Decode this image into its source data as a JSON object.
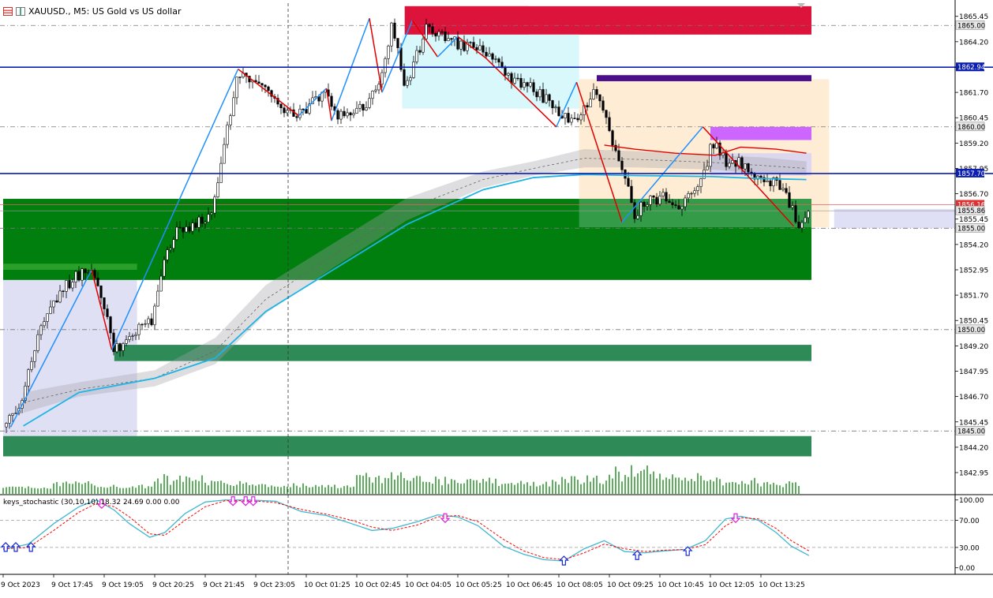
{
  "header": {
    "symbol_title": "XAUUSD., M5:  US Gold vs US dollar",
    "indicator_label": "keys_stochastic (30,10,10) 18.32 24.69 0.00 0.00"
  },
  "colors": {
    "bull": "#000000",
    "bear": "#000000",
    "hline": "#0b1fb0",
    "supply": "#dc143c",
    "demand": "#007f0e",
    "demand_light": "#2e8b57",
    "purple": "#4b0f8c",
    "violet": "#cc66ff",
    "zigzag_up": "#1e90ff",
    "zigzag_down": "#e00000",
    "ma_blue": "#1eb4e6",
    "stoch_main": "#3fb8d0",
    "stoch_signal": "#ff0000"
  },
  "chart_data": [
    {
      "type": "candlestick",
      "title": "XAUUSD., M5:  US Gold vs US dollar",
      "x_tick_labels": [
        "9 Oct 2023",
        "9 Oct 17:45",
        "9 Oct 19:05",
        "9 Oct 20:25",
        "9 Oct 21:45",
        "9 Oct 23:05",
        "10 Oct 01:25",
        "10 Oct 02:45",
        "10 Oct 04:05",
        "10 Oct 05:25",
        "10 Oct 06:45",
        "10 Oct 08:05",
        "10 Oct 09:25",
        "10 Oct 10:45",
        "10 Oct 12:05",
        "10 Oct 13:25"
      ],
      "y_tick_labels": [
        "1865.45",
        "1864.20",
        "1861.70",
        "1860.45",
        "1859.20",
        "1857.95",
        "1856.70",
        "1855.45",
        "1854.20",
        "1852.95",
        "1851.70",
        "1850.45",
        "1849.20",
        "1847.95",
        "1846.70",
        "1845.45",
        "1844.20",
        "1842.95"
      ],
      "ylim": [
        1841.9,
        1866.1
      ],
      "price_labels": [
        {
          "price": 1865.0,
          "text": "1865.00",
          "style": "grey"
        },
        {
          "price": 1862.94,
          "text": "1862.94",
          "style": "blue"
        },
        {
          "price": 1860.0,
          "text": "1860.00",
          "style": "grey"
        },
        {
          "price": 1857.7,
          "text": "1857.70",
          "style": "blue"
        },
        {
          "price": 1856.16,
          "text": "1856.16",
          "style": "red"
        },
        {
          "price": 1855.86,
          "text": "1855.86",
          "style": "grey"
        },
        {
          "price": 1855.0,
          "text": "1855.00",
          "style": "grey"
        },
        {
          "price": 1850.0,
          "text": "1850.00",
          "style": "grey"
        },
        {
          "price": 1845.0,
          "text": "1845.00",
          "style": "grey"
        }
      ],
      "horizontal_lines": [
        {
          "price": 1862.94,
          "style": "solid-blue"
        },
        {
          "price": 1857.7,
          "style": "solid-blue"
        },
        {
          "price": 1865.0,
          "style": "dash"
        },
        {
          "price": 1860.0,
          "style": "dash"
        },
        {
          "price": 1855.0,
          "style": "dash"
        },
        {
          "price": 1850.0,
          "style": "dash"
        },
        {
          "price": 1845.0,
          "style": "dash"
        },
        {
          "price": 1856.16,
          "style": "thin-red"
        },
        {
          "price": 1855.86,
          "style": "thin-grey"
        }
      ],
      "zones": [
        {
          "name": "supply-zone-top",
          "x0": 7.95,
          "x1": 16,
          "y0": 1864.55,
          "y1": 1865.95,
          "color": "#dc143c",
          "opacity": 1
        },
        {
          "name": "supply-zone-top-extension",
          "x0": 7.95,
          "x1": 10.4,
          "y0": 1864.55,
          "y1": 1865.95,
          "color": "#dc143c",
          "opacity": 0.85
        },
        {
          "name": "cyan-range-box",
          "x0": 7.9,
          "x1": 11.4,
          "y0": 1860.9,
          "y1": 1864.55,
          "color": "#c8f5fa",
          "opacity": 0.7
        },
        {
          "name": "peach-range-box",
          "x0": 11.4,
          "x1": 16.35,
          "y0": 1855.05,
          "y1": 1862.35,
          "color": "#fde7c6",
          "opacity": 0.75
        },
        {
          "name": "purple-zone",
          "x0": 11.75,
          "x1": 16,
          "y0": 1862.25,
          "y1": 1862.55,
          "color": "#4b0f8c",
          "opacity": 1
        },
        {
          "name": "violet-zone",
          "x0": 14.0,
          "x1": 16,
          "y0": 1859.35,
          "y1": 1860.0,
          "color": "#cc66ff",
          "opacity": 1
        },
        {
          "name": "lavender-zone-right",
          "x0": 14.0,
          "x1": 16,
          "y0": 1857.6,
          "y1": 1858.7,
          "color": "#d6d2f2",
          "opacity": 0.85
        },
        {
          "name": "lavender-zone-left",
          "x0": 0,
          "x1": 2.65,
          "y0": 1844.5,
          "y1": 1853.0,
          "color": "#d6d6f2",
          "opacity": 0.75
        },
        {
          "name": "demand-zone-main",
          "x0": 0,
          "x1": 16,
          "y0": 1852.45,
          "y1": 1856.45,
          "color": "#007f0e",
          "opacity": 1
        },
        {
          "name": "demand-zone-left",
          "x0": 0,
          "x1": 2.65,
          "y0": 1852.95,
          "y1": 1853.25,
          "color": "#2aa02a",
          "opacity": 1
        },
        {
          "name": "demand-zone-shade-right",
          "x0": 11.4,
          "x1": 16,
          "y0": 1855.05,
          "y1": 1856.45,
          "color": "#3aa050",
          "opacity": 0.9
        },
        {
          "name": "demand-zone-mid",
          "x0": 2.2,
          "x1": 16,
          "y0": 1848.45,
          "y1": 1849.25,
          "color": "#2e8b57",
          "opacity": 1
        },
        {
          "name": "demand-zone-low",
          "x0": 0,
          "x1": 16,
          "y0": 1843.75,
          "y1": 1844.75,
          "color": "#2e8b57",
          "opacity": 1
        },
        {
          "name": "lavender-zone-future",
          "x0": 16.45,
          "x1": 20,
          "y0": 1855.0,
          "y1": 1855.95,
          "color": "#dcdcf5",
          "opacity": 0.9
        }
      ],
      "price_path": [
        [
          0.0,
          1845.2
        ],
        [
          0.35,
          1846.5
        ],
        [
          0.7,
          1849.8
        ],
        [
          1.1,
          1851.8
        ],
        [
          1.45,
          1852.6
        ],
        [
          1.75,
          1852.9
        ],
        [
          2.05,
          1850.9
        ],
        [
          2.2,
          1849.0
        ],
        [
          2.6,
          1849.9
        ],
        [
          2.95,
          1850.5
        ],
        [
          3.2,
          1853.5
        ],
        [
          3.45,
          1854.9
        ],
        [
          3.8,
          1855.2
        ],
        [
          4.1,
          1855.5
        ],
        [
          4.35,
          1858.9
        ],
        [
          4.65,
          1862.7
        ],
        [
          5.0,
          1862.3
        ],
        [
          5.5,
          1861.0
        ],
        [
          5.85,
          1860.6
        ],
        [
          6.4,
          1861.8
        ],
        [
          6.55,
          1860.5
        ],
        [
          7.2,
          1861.1
        ],
        [
          7.5,
          1862.4
        ],
        [
          7.7,
          1865.3
        ],
        [
          7.95,
          1862.0
        ],
        [
          8.15,
          1863.2
        ],
        [
          8.4,
          1865.1
        ],
        [
          8.75,
          1864.3
        ],
        [
          9.1,
          1864.0
        ],
        [
          9.55,
          1863.7
        ],
        [
          10.0,
          1862.5
        ],
        [
          10.5,
          1861.9
        ],
        [
          11.0,
          1860.7
        ],
        [
          11.35,
          1860.3
        ],
        [
          11.7,
          1861.9
        ],
        [
          12.0,
          1859.8
        ],
        [
          12.2,
          1858.4
        ],
        [
          12.35,
          1857.2
        ],
        [
          12.5,
          1855.7
        ],
        [
          12.75,
          1856.3
        ],
        [
          13.1,
          1856.5
        ],
        [
          13.45,
          1856.0
        ],
        [
          13.9,
          1858.0
        ],
        [
          14.05,
          1859.3
        ],
        [
          14.3,
          1858.3
        ],
        [
          14.6,
          1858.2
        ],
        [
          14.95,
          1857.3
        ],
        [
          15.3,
          1857.2
        ],
        [
          15.55,
          1856.3
        ],
        [
          15.75,
          1855.2
        ],
        [
          15.95,
          1855.8
        ]
      ],
      "zigzag": [
        [
          0.15,
          1845.2
        ],
        [
          1.75,
          1852.95
        ],
        [
          2.15,
          1849.0
        ],
        [
          4.65,
          1862.85
        ],
        [
          5.85,
          1860.55
        ],
        [
          6.4,
          1861.9
        ],
        [
          6.5,
          1860.3
        ],
        [
          7.25,
          1865.35
        ],
        [
          7.5,
          1861.7
        ],
        [
          8.1,
          1865.25
        ],
        [
          8.6,
          1863.45
        ],
        [
          9.0,
          1864.45
        ],
        [
          9.55,
          1863.4
        ],
        [
          10.95,
          1860.0
        ],
        [
          11.35,
          1862.2
        ],
        [
          12.25,
          1855.3
        ],
        [
          13.85,
          1860.0
        ],
        [
          15.65,
          1855.1
        ]
      ],
      "ma_blue": [
        [
          0.4,
          1845.25
        ],
        [
          1.5,
          1846.9
        ],
        [
          3.0,
          1847.6
        ],
        [
          4.2,
          1848.6
        ],
        [
          5.2,
          1850.9
        ],
        [
          6.5,
          1852.9
        ],
        [
          8.0,
          1855.2
        ],
        [
          9.5,
          1856.9
        ],
        [
          10.5,
          1857.5
        ],
        [
          11.5,
          1857.65
        ],
        [
          12.5,
          1857.6
        ],
        [
          14.0,
          1857.55
        ],
        [
          15.0,
          1857.45
        ],
        [
          15.9,
          1857.4
        ]
      ],
      "ma_band_upper": [
        [
          0.4,
          1846.9
        ],
        [
          1.5,
          1847.4
        ],
        [
          3.0,
          1848.0
        ],
        [
          4.2,
          1849.6
        ],
        [
          5.2,
          1852.2
        ],
        [
          6.5,
          1854.2
        ],
        [
          8.0,
          1856.5
        ],
        [
          9.5,
          1857.8
        ],
        [
          10.5,
          1858.3
        ],
        [
          11.5,
          1858.9
        ],
        [
          12.5,
          1858.8
        ],
        [
          14.0,
          1858.6
        ],
        [
          15.0,
          1858.5
        ],
        [
          15.9,
          1858.3
        ]
      ],
      "ma_band_lower": [
        [
          0.4,
          1845.9
        ],
        [
          1.5,
          1846.7
        ],
        [
          3.0,
          1847.2
        ],
        [
          4.2,
          1848.3
        ],
        [
          5.2,
          1850.8
        ],
        [
          6.5,
          1853.0
        ],
        [
          8.0,
          1855.4
        ],
        [
          9.5,
          1857.0
        ],
        [
          10.5,
          1857.6
        ],
        [
          11.5,
          1858.0
        ],
        [
          12.5,
          1858.0
        ],
        [
          14.0,
          1857.9
        ],
        [
          15.0,
          1857.7
        ],
        [
          15.9,
          1857.6
        ]
      ],
      "red_envelope": [
        [
          11.9,
          1859.1
        ],
        [
          12.5,
          1858.9
        ],
        [
          13.3,
          1858.7
        ],
        [
          14.1,
          1858.6
        ],
        [
          14.6,
          1859.0
        ],
        [
          15.3,
          1858.9
        ],
        [
          15.9,
          1858.7
        ]
      ],
      "volume_profile": [
        0.1,
        0.25,
        0.15,
        0.45,
        0.35,
        0.2,
        0.15,
        0.5,
        0.4,
        0.35,
        0.3,
        0.45,
        0.7,
        0.5,
        0.35,
        0.25
      ]
    },
    {
      "type": "line",
      "title": "keys_stochastic (30,10,10) 18.32 24.69 0.00 0.00",
      "y_tick_labels": [
        "100.00",
        "70.00",
        "30.00",
        "0.00"
      ],
      "ylim": [
        -5,
        102
      ],
      "series": [
        {
          "values": [
            [
              0.0,
              27
            ],
            [
              0.5,
              35
            ],
            [
              1.0,
              65
            ],
            [
              1.5,
              90
            ],
            [
              1.85,
              100
            ],
            [
              2.2,
              85
            ],
            [
              2.5,
              65
            ],
            [
              2.9,
              45
            ],
            [
              3.2,
              52
            ],
            [
              3.6,
              80
            ],
            [
              4.0,
              97
            ],
            [
              4.4,
              100
            ],
            [
              4.9,
              100
            ],
            [
              5.4,
              98
            ],
            [
              5.9,
              83
            ],
            [
              6.4,
              77
            ],
            [
              6.9,
              65
            ],
            [
              7.3,
              55
            ],
            [
              7.7,
              58
            ],
            [
              8.2,
              68
            ],
            [
              8.6,
              78
            ],
            [
              9.0,
              75
            ],
            [
              9.4,
              62
            ],
            [
              9.9,
              32
            ],
            [
              10.3,
              20
            ],
            [
              10.7,
              12
            ],
            [
              11.1,
              10
            ],
            [
              11.5,
              28
            ],
            [
              11.9,
              40
            ],
            [
              12.3,
              24
            ],
            [
              12.7,
              22
            ],
            [
              13.1,
              25
            ],
            [
              13.5,
              27
            ],
            [
              13.9,
              40
            ],
            [
              14.3,
              72
            ],
            [
              14.6,
              76
            ],
            [
              14.95,
              70
            ],
            [
              15.3,
              52
            ],
            [
              15.6,
              32
            ],
            [
              15.95,
              18
            ]
          ]
        },
        {
          "values": [
            [
              0.0,
              28
            ],
            [
              0.5,
              30
            ],
            [
              1.0,
              55
            ],
            [
              1.5,
              82
            ],
            [
              1.85,
              95
            ],
            [
              2.2,
              90
            ],
            [
              2.5,
              75
            ],
            [
              2.9,
              50
            ],
            [
              3.2,
              48
            ],
            [
              3.6,
              70
            ],
            [
              4.0,
              90
            ],
            [
              4.4,
              99
            ],
            [
              4.9,
              99
            ],
            [
              5.4,
              96
            ],
            [
              5.9,
              86
            ],
            [
              6.4,
              79
            ],
            [
              6.9,
              70
            ],
            [
              7.3,
              60
            ],
            [
              7.7,
              55
            ],
            [
              8.2,
              63
            ],
            [
              8.6,
              75
            ],
            [
              9.0,
              77
            ],
            [
              9.4,
              68
            ],
            [
              9.9,
              42
            ],
            [
              10.3,
              25
            ],
            [
              10.7,
              15
            ],
            [
              11.1,
              12
            ],
            [
              11.5,
              22
            ],
            [
              11.9,
              35
            ],
            [
              12.3,
              28
            ],
            [
              12.7,
              24
            ],
            [
              13.1,
              26
            ],
            [
              13.5,
              27
            ],
            [
              13.9,
              34
            ],
            [
              14.3,
              62
            ],
            [
              14.6,
              74
            ],
            [
              14.95,
              72
            ],
            [
              15.3,
              58
            ],
            [
              15.6,
              40
            ],
            [
              15.95,
              25
            ]
          ]
        }
      ],
      "up_arrows": [
        [
          0.05,
          30
        ],
        [
          0.25,
          30
        ],
        [
          0.55,
          30
        ],
        [
          11.1,
          10
        ],
        [
          12.55,
          18
        ],
        [
          13.55,
          24
        ]
      ],
      "down_arrows": [
        [
          1.95,
          96
        ],
        [
          4.55,
          100
        ],
        [
          4.8,
          100
        ],
        [
          4.95,
          100
        ],
        [
          8.75,
          75
        ],
        [
          14.5,
          75
        ]
      ]
    }
  ]
}
